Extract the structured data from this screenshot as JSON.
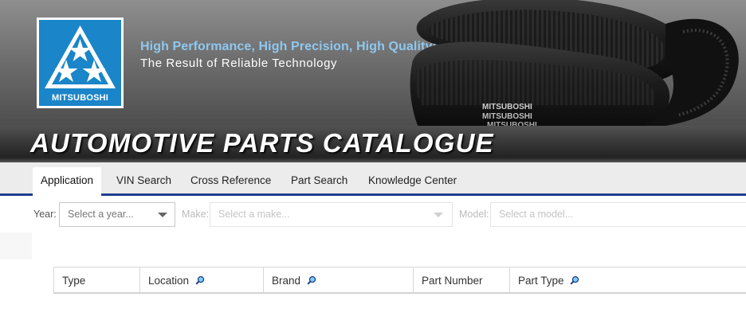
{
  "banner": {
    "logo_text": "MITSUBOSHI",
    "tagline_primary": "High Performance, High Precision, High Quality:",
    "tagline_secondary": "The Result of Reliable Technology",
    "belt_labels": [
      "MITSUBOSHI",
      "MITSUBOSHI",
      "MITSUBOSHI"
    ]
  },
  "title": "AUTOMOTIVE PARTS CATALOGUE",
  "nav": {
    "tabs": [
      {
        "label": "Application",
        "active": true
      },
      {
        "label": "VIN Search",
        "active": false
      },
      {
        "label": "Cross Reference",
        "active": false
      },
      {
        "label": "Part Search",
        "active": false
      },
      {
        "label": "Knowledge Center",
        "active": false
      }
    ]
  },
  "filters": {
    "year": {
      "label": "Year:",
      "placeholder": "Select a year..."
    },
    "make": {
      "label": "Make:",
      "placeholder": "Select a make..."
    },
    "model": {
      "label": "Model:",
      "placeholder": "Select a model..."
    }
  },
  "table": {
    "columns": [
      {
        "label": "Type",
        "searchable": false
      },
      {
        "label": "Location",
        "searchable": true
      },
      {
        "label": "Brand",
        "searchable": true
      },
      {
        "label": "Part Number",
        "searchable": false
      },
      {
        "label": "Part Type",
        "searchable": true
      }
    ]
  },
  "colors": {
    "brand_blue": "#1a85c8",
    "nav_accent": "#1f3f8f",
    "tagline_blue": "#8ec8ef"
  },
  "icons": {
    "column_search": "magnifier-icon",
    "dropdown": "caret-down-icon",
    "logo": "three-diamonds-logo"
  }
}
